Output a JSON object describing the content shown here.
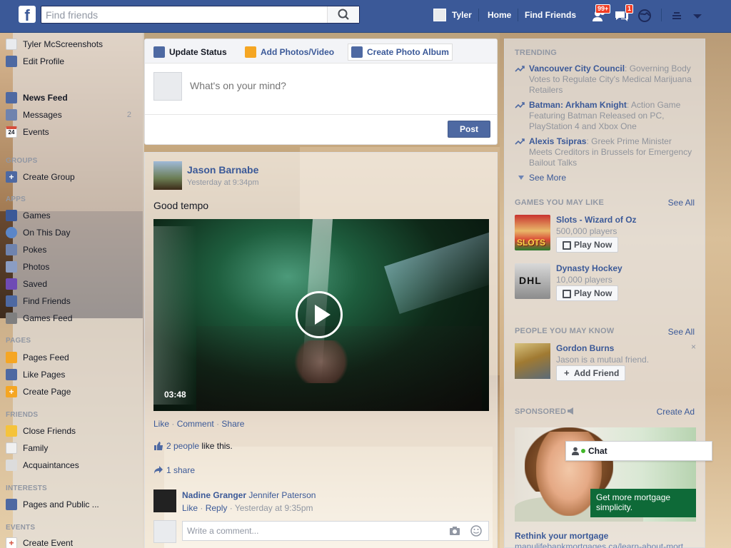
{
  "topbar": {
    "logo": "f",
    "search_placeholder": "Find friends",
    "user_name": "Tyler",
    "links": [
      "Home",
      "Find Friends"
    ],
    "friend_requests_badge": "99+",
    "messages_badge": "1"
  },
  "leftnav": {
    "profile_name": "Tyler McScreenshots",
    "edit_profile": "Edit Profile",
    "favorites": [
      {
        "label": "News Feed",
        "bold": true
      },
      {
        "label": "Messages",
        "count": "2"
      },
      {
        "label": "Events"
      }
    ],
    "events_day": "24",
    "groups_header": "GROUPS",
    "create_group": "Create Group",
    "apps_header": "APPS",
    "apps": [
      "Games",
      "On This Day",
      "Pokes",
      "Photos",
      "Saved",
      "Find Friends",
      "Games Feed"
    ],
    "pages_header": "PAGES",
    "pages": [
      "Pages Feed",
      "Like Pages",
      "Create Page"
    ],
    "friends_header": "FRIENDS",
    "friends": [
      "Close Friends",
      "Family",
      "Acquaintances"
    ],
    "interests_header": "INTERESTS",
    "interests": [
      "Pages and Public ..."
    ],
    "events_header": "EVENTS",
    "create_event": "Create Event"
  },
  "composer": {
    "tabs": [
      "Update Status",
      "Add Photos/Video",
      "Create Photo Album"
    ],
    "placeholder": "What's on your mind?",
    "post_button": "Post"
  },
  "story": {
    "author": "Jason Barnabe",
    "timestamp": "Yesterday at 9:34pm",
    "text": "Good tempo",
    "video_duration": "03:48",
    "actions": [
      "Like",
      "Comment",
      "Share"
    ],
    "likes_link": "2 people",
    "likes_suffix": "like this.",
    "shares": "1 share",
    "comment": {
      "commenter": "Nadine Granger",
      "tagged": "Jennifer Paterson",
      "like": "Like",
      "reply": "Reply",
      "time": "Yesterday at 9:35pm"
    },
    "write_comment_placeholder": "Write a comment..."
  },
  "right": {
    "trending_header": "TRENDING",
    "trending": [
      {
        "topic": "Vancouver City Council",
        "desc": ": Governing Body Votes to Regulate City's Medical Marijuana Retailers"
      },
      {
        "topic": "Batman: Arkham Knight",
        "desc": ": Action Game Featuring Batman Released on PC, PlayStation 4 and Xbox One"
      },
      {
        "topic": "Alexis Tsipras",
        "desc": ": Greek Prime Minister Meets Creditors in Brussels for Emergency Bailout Talks"
      }
    ],
    "see_more": "See More",
    "games_header": "GAMES YOU MAY LIKE",
    "see_all": "See All",
    "games": [
      {
        "name": "Slots - Wizard of Oz",
        "players": "500,000 players",
        "button": "Play Now",
        "logo_text": "SLOTS"
      },
      {
        "name": "Dynasty Hockey",
        "players": "10,000 players",
        "button": "Play Now",
        "logo_text": "DHL"
      }
    ],
    "pymk_header": "PEOPLE YOU MAY KNOW",
    "pymk": {
      "name": "Gordon Burns",
      "mutual": "Jason is a mutual friend.",
      "button": "Add Friend",
      "close": "×"
    },
    "sponsored_header": "SPONSORED",
    "create_ad": "Create Ad",
    "ad": {
      "caption": "Get more mortgage simplicity.",
      "title": "Rethink your mortgage",
      "url": "manulifebankmortgages.ca/learn-about-mort..."
    }
  },
  "chat": {
    "label": "Chat"
  },
  "colors": {
    "brand": "#3b5998",
    "badge": "#f03d25",
    "online": "#42b72a"
  }
}
